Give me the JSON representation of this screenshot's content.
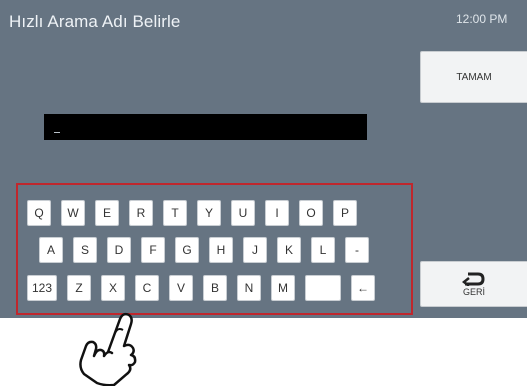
{
  "header": {
    "title": "Hızlı Arama Adı Belirle",
    "time": "12:00 PM"
  },
  "buttons": {
    "ok_label": "TAMAM",
    "back_label": "GERİ"
  },
  "text_field": {
    "value": ""
  },
  "keyboard": {
    "row1": [
      "Q",
      "W",
      "E",
      "R",
      "T",
      "Y",
      "U",
      "I",
      "O",
      "P"
    ],
    "row2": [
      "A",
      "S",
      "D",
      "F",
      "G",
      "H",
      "J",
      "K",
      "L",
      "-"
    ],
    "row3": [
      "123",
      "Z",
      "X",
      "C",
      "V",
      "B",
      "N",
      "M",
      "",
      "←"
    ]
  }
}
